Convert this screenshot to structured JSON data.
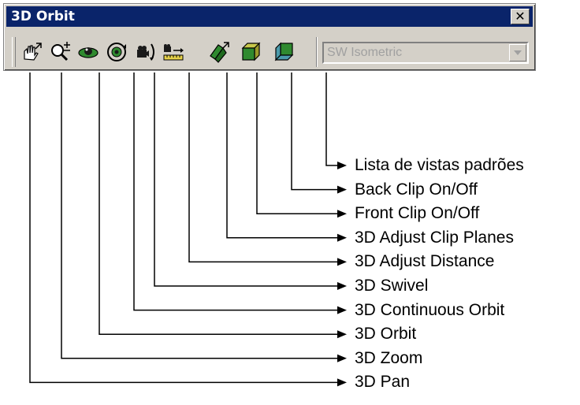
{
  "window": {
    "title": "3D Orbit",
    "close_label": "✕"
  },
  "tools": [
    {
      "id": "pan",
      "icon": "pan-hand-icon"
    },
    {
      "id": "zoom",
      "icon": "zoom-magnifier-icon"
    },
    {
      "id": "orbit",
      "icon": "orbit-icon"
    },
    {
      "id": "continuous-orbit",
      "icon": "continuous-orbit-icon"
    },
    {
      "id": "swivel",
      "icon": "swivel-camera-icon"
    },
    {
      "id": "adjust-distance",
      "icon": "adjust-distance-icon"
    },
    {
      "id": "adjust-clip-planes",
      "icon": "clip-planes-icon"
    },
    {
      "id": "front-clip",
      "icon": "front-clip-icon"
    },
    {
      "id": "back-clip",
      "icon": "back-clip-icon"
    }
  ],
  "view_select": {
    "value": "SW Isometric"
  },
  "callouts": [
    "Lista de vistas padrões",
    "Back Clip On/Off",
    "Front Clip On/Off",
    "3D Adjust Clip Planes",
    "3D Adjust Distance",
    "3D Swivel",
    "3D Continuous Orbit",
    "3D Orbit",
    "3D Zoom",
    "3D Pan"
  ]
}
